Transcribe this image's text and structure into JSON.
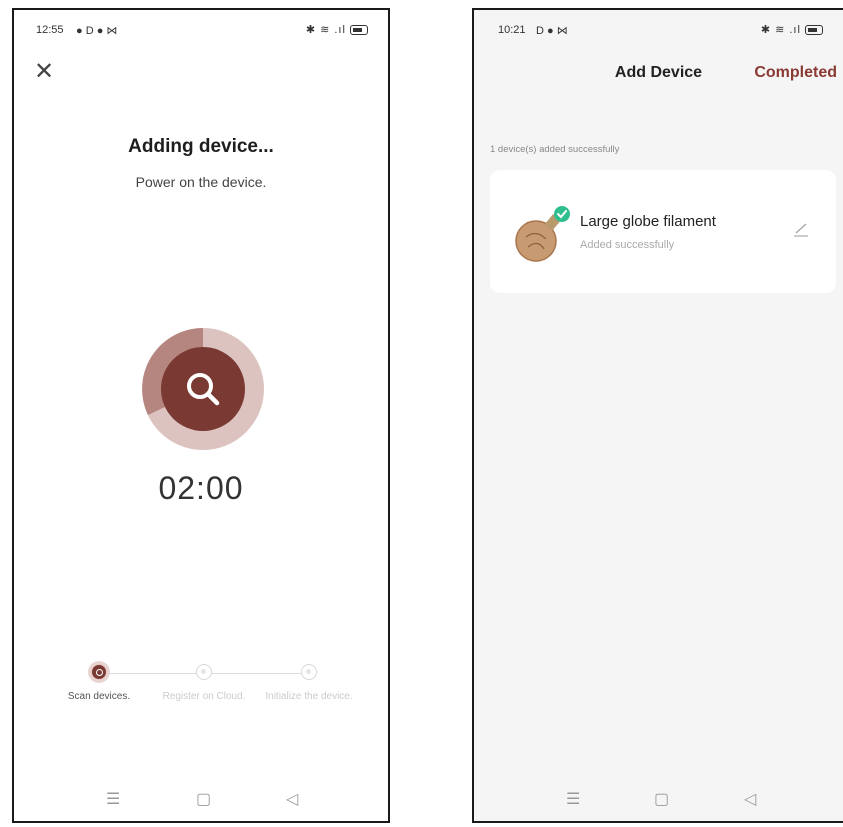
{
  "left_screen": {
    "status_time": "12:55",
    "status_icons": "● D ● ⋈",
    "close_icon": "close-icon",
    "title": "Adding device...",
    "subtitle": "Power on the device.",
    "timer": "02:00",
    "steps": [
      {
        "label": "Scan devices.",
        "active": true
      },
      {
        "label": "Register on Cloud.",
        "active": false
      },
      {
        "label": "Initialize the device.",
        "active": false
      }
    ],
    "accent_color": "#7a3a33"
  },
  "right_screen": {
    "status_time": "10:21",
    "status_icons": "D ● ⋈",
    "title": "Add Device",
    "completed_label": "Completed",
    "added_count_text": "1 device(s) added successfully",
    "device": {
      "name": "Large globe filament",
      "status": "Added successfully"
    },
    "accent_color": "#8a3a33"
  }
}
